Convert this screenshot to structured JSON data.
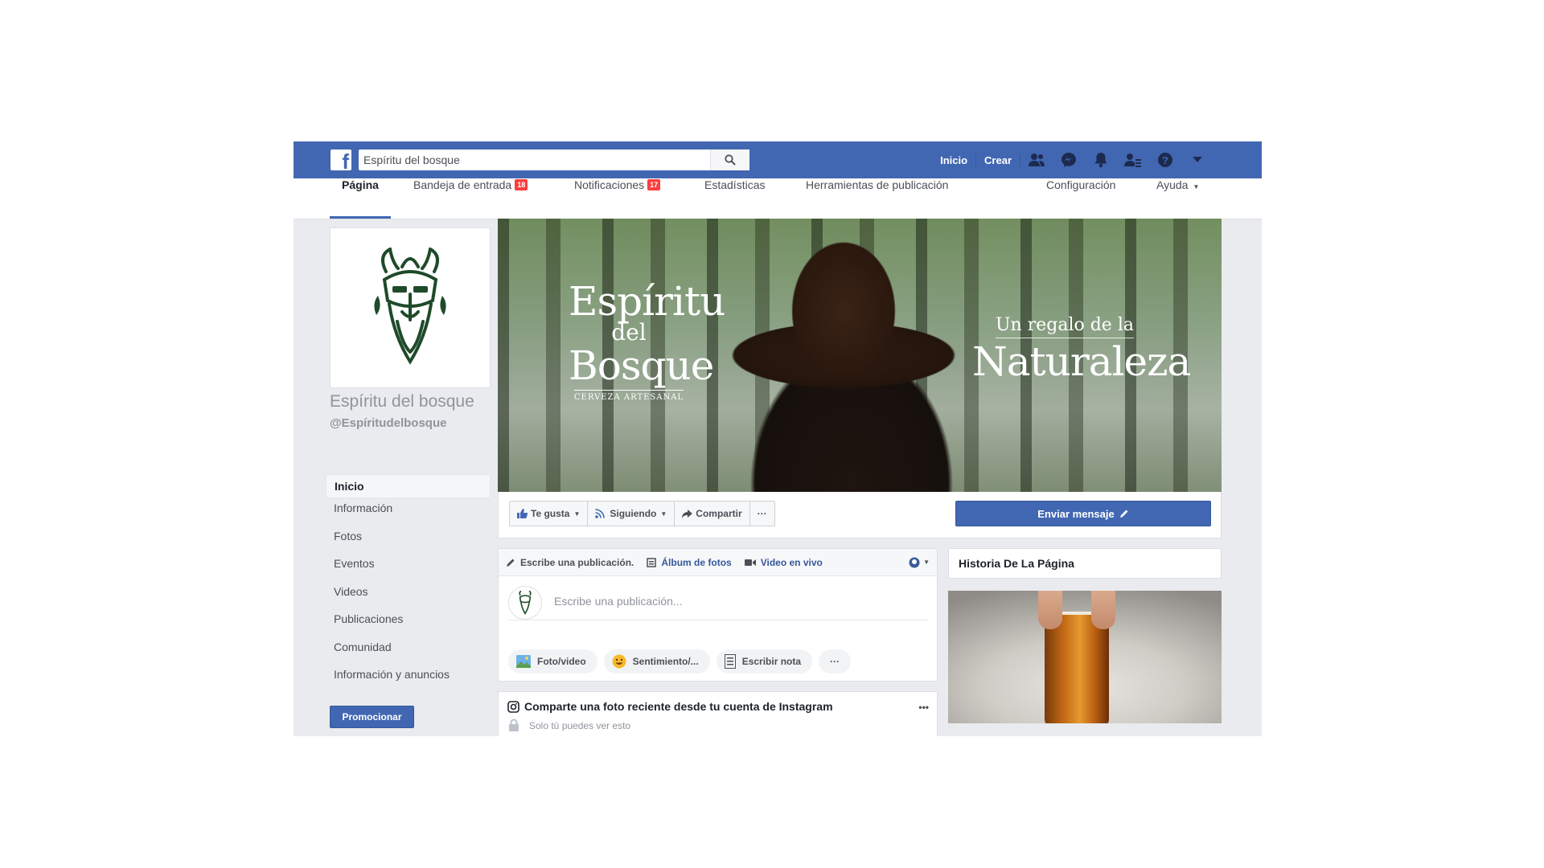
{
  "topbar": {
    "logo": "f",
    "search_value": "Espíritu del bosque",
    "nav": [
      "Inicio",
      "Crear"
    ],
    "icons": [
      "friends-icon",
      "messenger-icon",
      "notifications-icon",
      "friend-requests-icon",
      "help-icon",
      "dropdown-arrow-icon"
    ]
  },
  "tabs": {
    "pagina": "Página",
    "bandeja": "Bandeja de entrada",
    "bandeja_count": "18",
    "notificaciones": "Notificaciones",
    "notificaciones_count": "17",
    "estadisticas": "Estadísticas",
    "herramientas": "Herramientas de publicación",
    "configuracion": "Configuración",
    "ayuda": "Ayuda"
  },
  "profile": {
    "name": "Espíritu del bosque",
    "handle": "@Espíritudelbosque"
  },
  "sidebar": {
    "items": [
      {
        "label": "Inicio"
      },
      {
        "label": "Información"
      },
      {
        "label": "Fotos"
      },
      {
        "label": "Eventos"
      },
      {
        "label": "Videos"
      },
      {
        "label": "Publicaciones"
      },
      {
        "label": "Comunidad"
      },
      {
        "label": "Información y anuncios"
      }
    ],
    "promote": "Promocionar"
  },
  "cover": {
    "brand_line1": "Espíritu",
    "brand_line2": "del",
    "brand_line3": "Bosque",
    "brand_tagline": "CERVEZA ARTESANAL",
    "slogan_line1": "Un regalo de la",
    "slogan_line2": "Naturaleza"
  },
  "actions": {
    "like": "Te gusta",
    "following": "Siguiendo",
    "share": "Compartir",
    "more": "···",
    "message": "Enviar mensaje"
  },
  "composer": {
    "tab_write": "Escribe una publicación.",
    "tab_album": "Álbum de fotos",
    "tab_live": "Video en vivo",
    "placeholder": "Escribe una publicación...",
    "chips": [
      "Foto/video",
      "Sentimiento/...",
      "Escribir nota",
      "···"
    ]
  },
  "instagram": {
    "title": "Comparte una foto reciente desde tu cuenta de Instagram",
    "subtitle": "Solo tú puedes ver esto",
    "menu": "•••"
  },
  "story": {
    "title": "Historia De La Página"
  },
  "colors": {
    "brand_blue": "#4267b2",
    "badge_red": "#fa3e3e",
    "page_bg": "#e9ebee"
  }
}
